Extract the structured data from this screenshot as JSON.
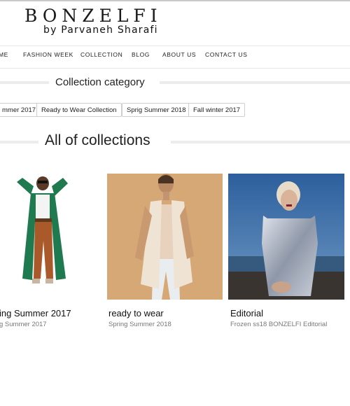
{
  "header": {
    "brand": "BONZELFI",
    "byline": "by Parvaneh Sharafi"
  },
  "nav": {
    "items": [
      "ME",
      "FASHION WEEK",
      "COLLECTION",
      "BLOG",
      "ABOUT US",
      "CONTACT US"
    ]
  },
  "category": {
    "title": "Collection category",
    "tags": [
      "mmer 2017",
      "Ready to Wear Collection",
      "Sprig Summer 2018",
      "Fall winter 2017"
    ]
  },
  "collections": {
    "title": "All of collections",
    "cards": [
      {
        "title": "ing Summer 2017",
        "subtitle": "g Summer 2017"
      },
      {
        "title": "ready to wear",
        "subtitle": "Spring Summer 2018"
      },
      {
        "title": "Editorial",
        "subtitle": "Frozen ss18 BONZELFI Editorial"
      }
    ]
  },
  "colors": {
    "photo1_bg": "#ffffff",
    "photo2_bg": "#d6a876",
    "photo3_sky": "#3f6fa6",
    "coat_green": "#1f7a4f",
    "pants_rust": "#a9592a"
  }
}
